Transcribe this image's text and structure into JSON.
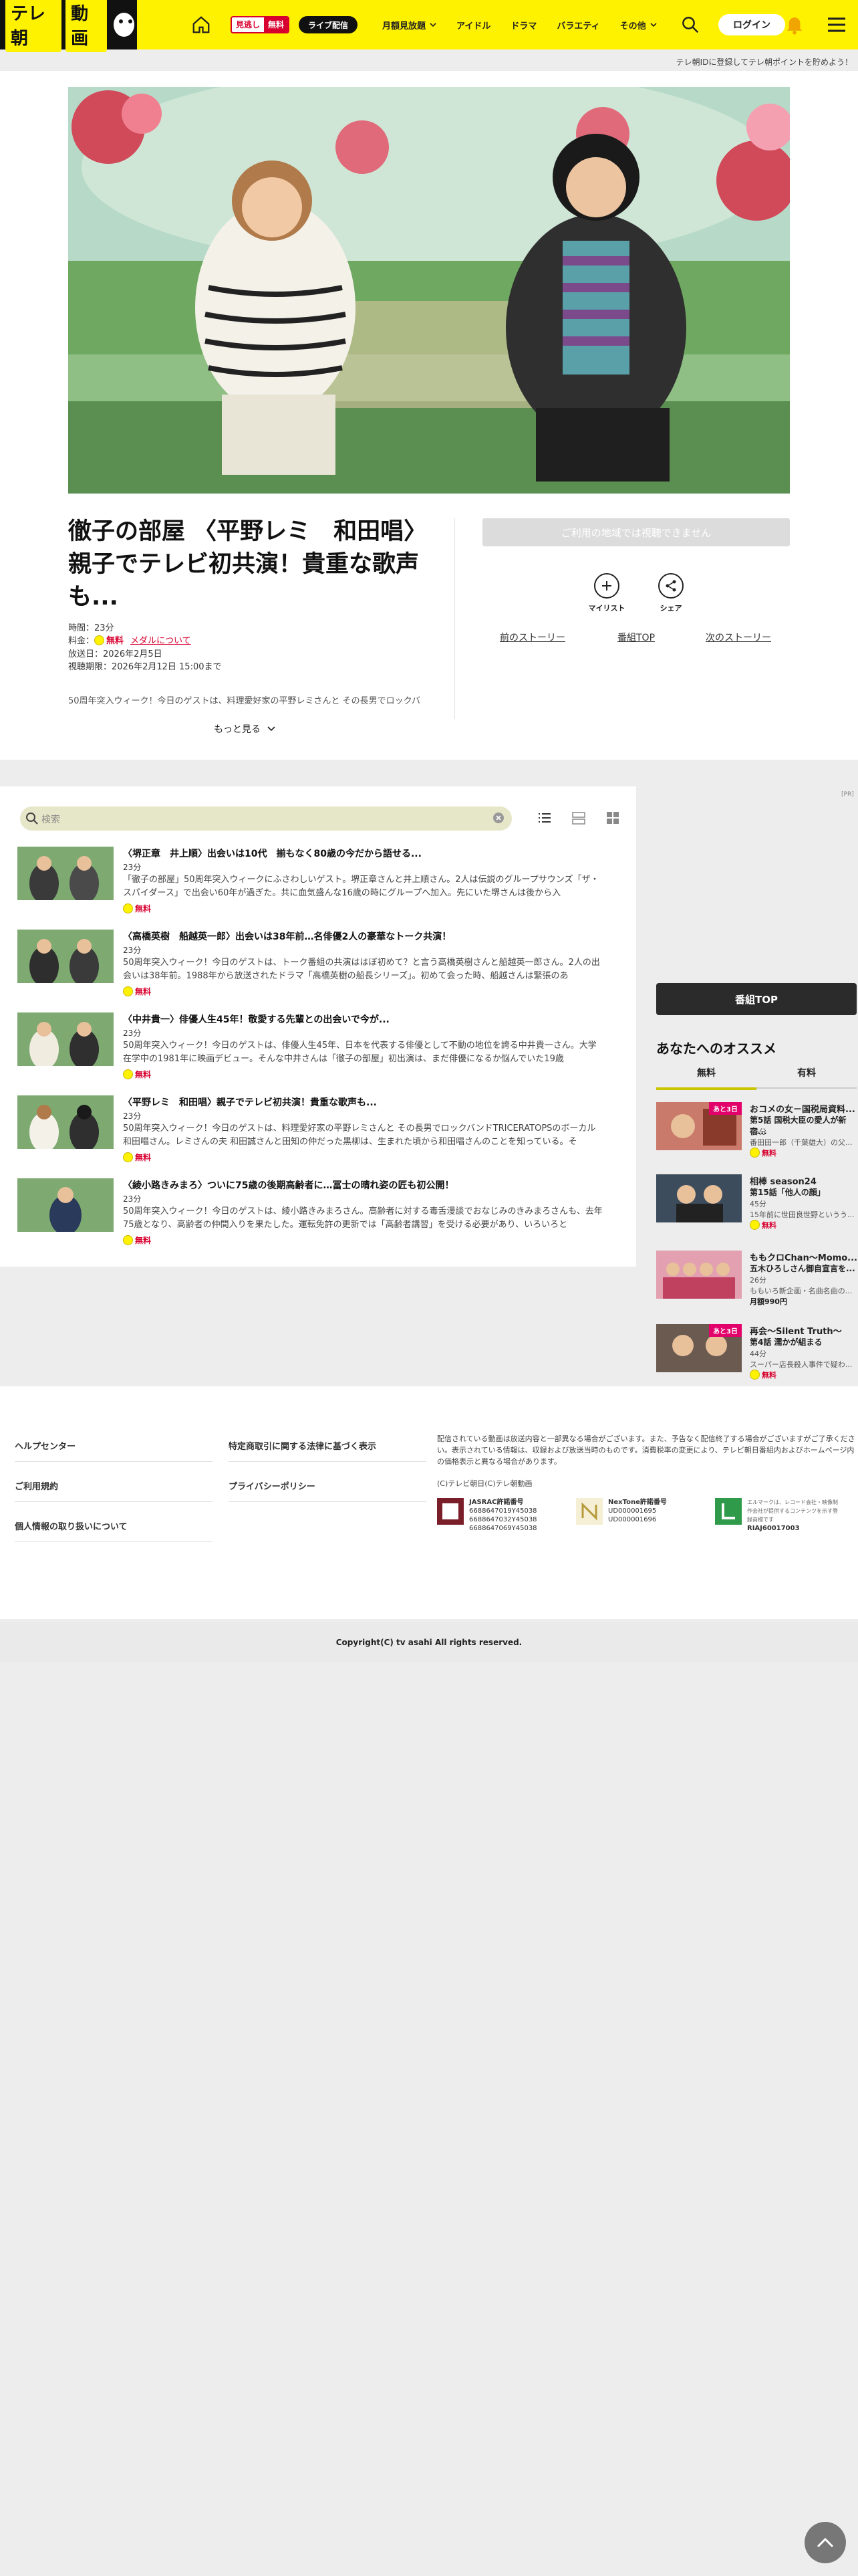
{
  "header": {
    "logo_text": "テレ朝",
    "logo_text2": "動画",
    "mitori_a": "見逃し",
    "mitori_b": "無料",
    "live_label": "ライブ配信",
    "nav": [
      "月額見放題",
      "アイドル",
      "ドラマ",
      "バラエティ",
      "その他"
    ],
    "login": "ログイン",
    "promo": "テレ朝IDに登録してテレ朝ポイントを貯めよう！"
  },
  "episode": {
    "title": "徹子の部屋 〈平野レミ　和田唱〉親子でテレビ初共演！貴重な歌声も...",
    "duration": "時間：23分",
    "price_label": "料金：",
    "price_free": "無料",
    "plan_link": "メダルについて",
    "aired": "放送日：2026年2月5日",
    "deadline": "視聴期限：2026年2月12日 15:00まで",
    "synopsis": "50周年突入ウィーク！今日のゲストは、料理愛好家の平野レミさんと その長男でロックバ",
    "more": "もっと見る",
    "watch_btn": "ご利用の地域では視聴できません",
    "mylist": "マイリスト",
    "share": "シェア",
    "prev": "前のストーリー",
    "top": "番組TOP",
    "next": "次のストーリー"
  },
  "list": {
    "search_placeholder": "検索",
    "free": "無料",
    "items": [
      {
        "title": "〈堺正章　井上順〉出会いは10代　揃もなく80歳の今だから語せる...",
        "dur": "23分",
        "desc": "「徹子の部屋」50周年突入ウィークにふさわしいゲスト。堺正章さんと井上順さん。2人は伝説のグループサウンズ「ザ・スパイダース」で出会い60年が過ぎた。共に血気盛んな16歳の時にグループへ加入。先にいた堺さんは後から入"
      },
      {
        "title": "〈高橋英樹　船越英一郎〉出会いは38年前…名俳優2人の豪華なトーク共演！",
        "dur": "23分",
        "desc": "50周年突入ウィーク！今日のゲストは、トーク番組の共演ははぼ初めて？と言う高橋英樹さんと船越英一郎さん。2人の出会いは38年前。1988年から放送されたドラマ「高橋英樹の船長シリーズ」。初めて会った時、船越さんは緊張のあ"
      },
      {
        "title": "〈中井貴一〉俳優人生45年！敬愛する先輩との出会いで今が...",
        "dur": "23分",
        "desc": "50周年突入ウィーク！今日のゲストは、俳優人生45年、日本を代表する俳優として不動の地位を誇る中井貴一さん。大学在学中の1981年に映画デビュー。そんな中井さんは「徹子の部屋」初出演は、まだ俳優になるか悩んでいた19歳"
      },
      {
        "title": "〈平野レミ　和田唱〉親子でテレビ初共演！貴重な歌声も...",
        "dur": "23分",
        "desc": "50周年突入ウィーク！今日のゲストは、料理愛好家の平野レミさんと その長男でロックバンドTRICERATOPSのボーカル 和田唱さん。レミさんの夫 和田誠さんと田知の仲だった黒柳は、生まれた頃から和田唱さんのことを知っている。そ"
      },
      {
        "title": "〈綾小路きみまろ〉ついに75歳の後期高齢者に…冨士の晴れ姿の匠も初公開！",
        "dur": "23分",
        "desc": "50周年突入ウィーク！今日のゲストは、綾小路きみまろさん。高齢者に対する毒舌漫談でおなじみのきみまろさんも、去年75歳となり、高齢者の仲間入りを果たした。運転免許の更新では「高齢者講習」を受ける必要があり、いろいろと"
      }
    ]
  },
  "sidebar": {
    "pr": "[PR]",
    "top_btn": "番組TOP",
    "heading": "あなたへのオススメ",
    "tab_free": "無料",
    "tab_paid": "有料",
    "recs": [
      {
        "badge": "あと3日",
        "title": "おコメの女－国税局資料...",
        "sub": "第5話 国税大臣の愛人が新宿...",
        "line1": "45分",
        "line2": "番田田一郎（千葉雄大）の父...",
        "price": "無料"
      },
      {
        "badge": "",
        "title": "相棒 season24",
        "sub": "第15話「他人の顔」",
        "line1": "45分",
        "line2": "15年前に世田良世野というう...",
        "price": "無料"
      },
      {
        "badge": "",
        "title": "ももクロChan～Momo...",
        "sub": "五木ひろしさん御自宣言を...",
        "line1": "26分",
        "line2": "ももいろ新企画・名曲名曲の...",
        "price": "月額990円"
      },
      {
        "badge": "あと3日",
        "title": "再会～Silent Truth～",
        "sub": "第4話 濡かが組まる",
        "line1": "44分",
        "line2": "スーパー店長殺人事件で疑わ...",
        "price": "無料"
      }
    ]
  },
  "footer": {
    "links_left": [
      "ヘルプセンター",
      "ご利用規約",
      "個人情報の取り扱いについて"
    ],
    "links_right": [
      "特定商取引に関する法律に基づく表示",
      "プライバシーポリシー"
    ],
    "note": "配信されている動画は放送内容と一部異なる場合がございます。また、予告なく配信終了する場合がございますがご了承ください。表示されている情報は、収録および放送当時のものです。消費税率の変更により、テレビ朝日番組内およびホームページ内の価格表示と異なる場合があります。",
    "copyright_tv": "(C)テレビ朝日(C)テレ朝動画",
    "jasrac_title": "JASRAC許諾番号",
    "jasrac_nums": "6688647019Y45038\n6688647032Y45038\n6688647069Y45038",
    "nextone_title": "NexTone許諾番号",
    "nextone_nums": "UD000001695\nUD000001696",
    "riaj_text": "エルマークは、レコード会社・映像制作会社が提供するコンテンツを示す登録商標です",
    "riaj_num": "RIAJ60017003",
    "copyright": "Copyright(C) tv asahi All rights reserved."
  },
  "colors": {
    "brand_yellow": "#fff200",
    "free_red": "#d8002e",
    "badge_pink": "#e2006a"
  }
}
